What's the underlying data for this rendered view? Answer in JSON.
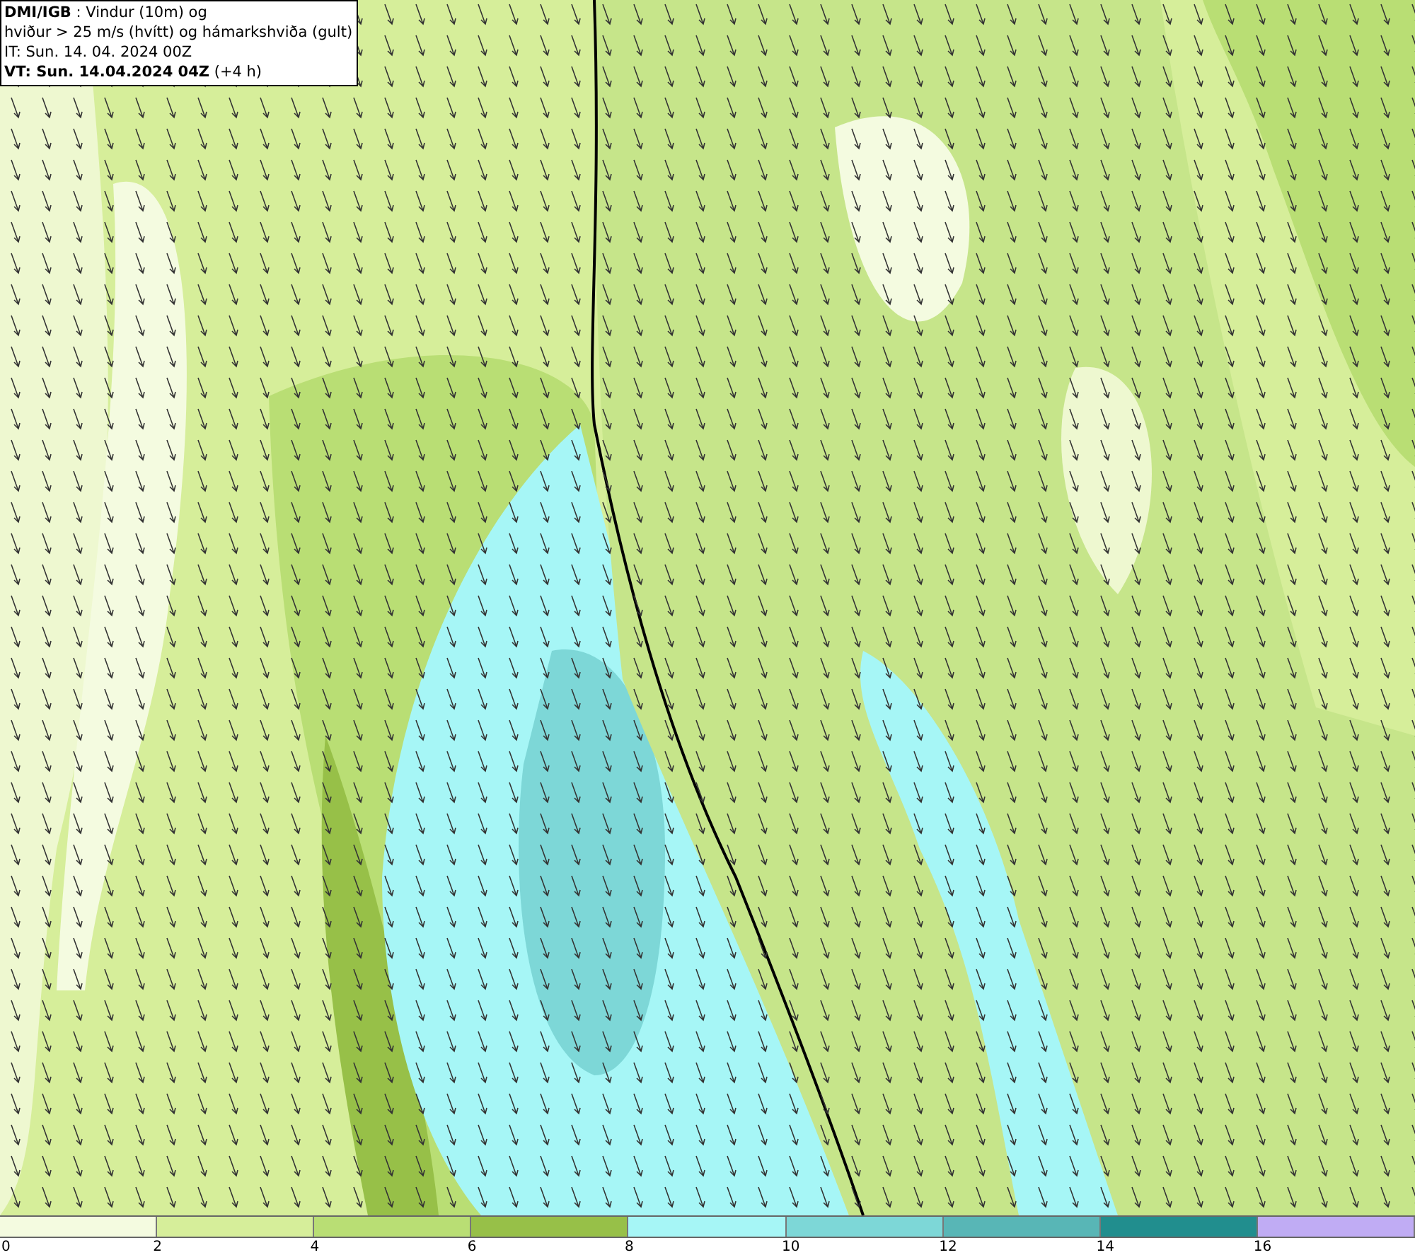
{
  "title_box": {
    "lines": [
      "**DMI/IGB** : Vindur (10m) og",
      "hviður > 25 m/s (hvítt) og hámarkshviða (gult)",
      "IT: Sun. 14. 04. 2024 00Z",
      "**VT: Sun. 14.04.2024 04Z** (+4 h)"
    ]
  },
  "legend": {
    "segments": [
      {
        "label": "0",
        "color": "#f4fbe0"
      },
      {
        "label": "2",
        "color": "#d6ee9a"
      },
      {
        "label": "4",
        "color": "#b9de74"
      },
      {
        "label": "6",
        "color": "#97c048"
      },
      {
        "label": "8",
        "color": "#a6f6f6"
      },
      {
        "label": "10",
        "color": "#7dd7d7"
      },
      {
        "label": "12",
        "color": "#58b6b6"
      },
      {
        "label": "14",
        "color": "#218e8e"
      },
      {
        "label": "16",
        "color": "#c0acf4"
      }
    ]
  }
}
